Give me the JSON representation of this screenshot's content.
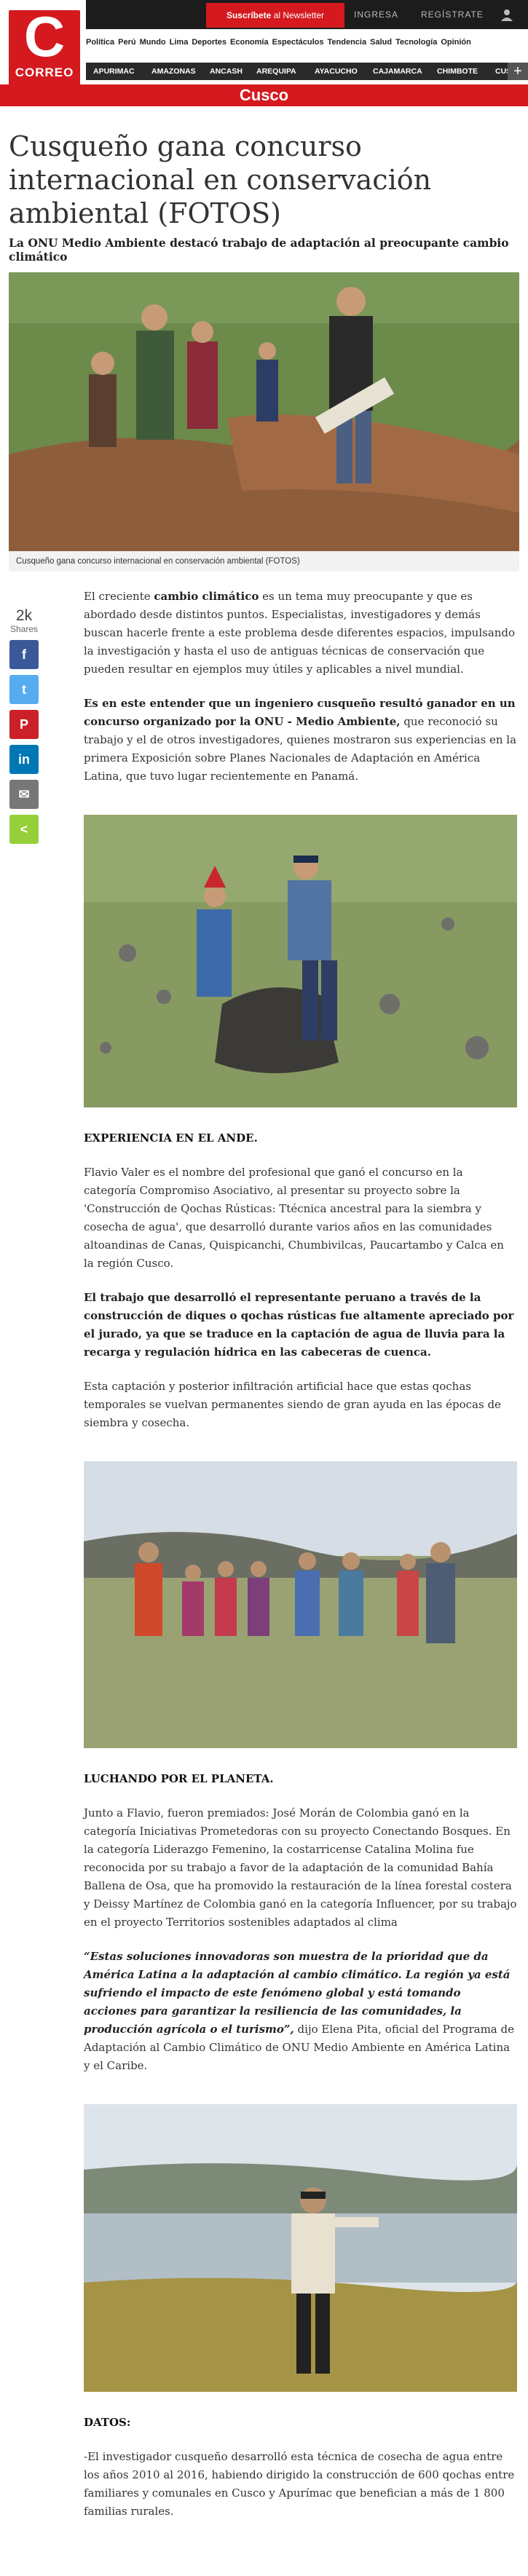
{
  "header": {
    "logo_text": "CORREO",
    "logo_letter": "C",
    "newsletter_prefix": "Suscríbete",
    "newsletter_suffix": "al Newsletter",
    "login": "INGRESA",
    "register": "REGÍSTRATE",
    "sections": [
      "Política",
      "Perú",
      "Mundo",
      "Lima",
      "Deportes",
      "Economía",
      "Espectáculos",
      "Tendencia",
      "Salud",
      "Tecnología",
      "Opinión"
    ],
    "regions": [
      "APURIMAC",
      "AMAZONAS",
      "ANCASH",
      "AREQUIPA",
      "AYACUCHO",
      "CAJAMARCA",
      "CHIMBOTE",
      "CUSCO"
    ],
    "plus": "+"
  },
  "section_title": "Cusco",
  "article": {
    "title": "Cusqueño gana concurso internacional en conservación ambiental (FOTOS)",
    "subtitle": "La ONU Medio Ambiente destacó trabajo de adaptación al preocupante cambio climático",
    "caption": "Cusqueño gana concurso internacional en conservación ambiental (FOTOS)"
  },
  "share": {
    "count": "2k",
    "label": "Shares",
    "buttons": [
      {
        "name": "facebook",
        "glyph": "f",
        "color": "#3b5998"
      },
      {
        "name": "twitter",
        "glyph": "t",
        "color": "#55acee"
      },
      {
        "name": "pinterest",
        "glyph": "P",
        "color": "#cb2027"
      },
      {
        "name": "linkedin",
        "glyph": "in",
        "color": "#0077b5"
      },
      {
        "name": "email",
        "glyph": "✉",
        "color": "#777777"
      },
      {
        "name": "share",
        "glyph": "<",
        "color": "#95d03a"
      }
    ]
  },
  "body": {
    "p1_a": "El creciente ",
    "p1_b": "cambio climático",
    "p1_c": " es un tema muy preocupante y que es abordado desde distintos puntos. Especialistas, investigadores y demás buscan hacerle frente a este problema desde diferentes espacios, impulsando la investigación y hasta el uso de antiguas técnicas de conservación que pueden resultar en ejemplos muy útiles y aplicables a nivel mundial.",
    "p2_a": "Es en este entender que un ingeniero cusqueño resultó ganador en un concurso organizado por la ONU - Medio Ambiente,",
    "p2_b": " que reconoció su trabajo y el de otros investigadores, quienes mostraron sus experiencias en la primera Exposición sobre Planes Nacionales de Adaptación en América Latina, que tuvo lugar recientemente en Panamá.",
    "h1": "EXPERIENCIA EN EL ANDE.",
    "p3": "Flavio Valer es el nombre del profesional que ganó el concurso en la categoría Compromiso Asociativo, al presentar su proyecto sobre la 'Construcción de Qochas Rústicas: Ttécnica ancestral para la siembra y cosecha de agua', que desarrolló durante varios años en las comunidades altoandinas de Canas, Quispicanchi, Chumbivilcas, Paucartambo y Calca en la región Cusco.",
    "p4": "El trabajo que desarrolló el representante peruano a través de la construcción de diques o qochas rústicas fue altamente apreciado por el jurado, ya que se traduce en la captación de agua de lluvia para la recarga y regulación hídrica en las cabeceras de cuenca.",
    "p5": "Esta captación y posterior infiltración artificial hace que estas qochas temporales se vuelvan permanentes siendo de gran ayuda en las épocas de siembra y cosecha.",
    "h2": "LUCHANDO POR EL PLANETA.",
    "p6": "Junto a Flavio, fueron premiados: José Morán de Colombia ganó en la categoría Iniciativas Prometedoras con su proyecto Conectando Bosques. En la categoría Liderazgo Femenino, la costarricense Catalina Molina fue reconocida por su trabajo a favor de la adaptación de la comunidad Bahía Ballena de Osa, que ha promovido la restauración de la línea forestal costera y Deissy Martínez de Colombia ganó en la categoría Influencer, por su trabajo en el proyecto Territorios sostenibles adaptados al clima",
    "p7_quote": "“Estas soluciones innovadoras son muestra de la prioridad que da América Latina a la adaptación al cambio climático. La región ya está sufriendo el impacto de este fenómeno global y está tomando acciones para garantizar la resiliencia de las comunidades, la producción agrícola o el turismo”,",
    "p7_rest": " dijo Elena Pita, oficial del Programa de Adaptación al Cambio Climático de ONU Medio Ambiente en América Latina y el Caribe.",
    "h3": "DATOS:",
    "p8": "-El investigador cusqueño desarrolló esta técnica de cosecha de agua entre los años 2010 al 2016, habiendo dirigido la construcción de 600 qochas entre familiares y comunales en Cusco y Apurímac que benefician a más de 1 800 familias rurales."
  }
}
